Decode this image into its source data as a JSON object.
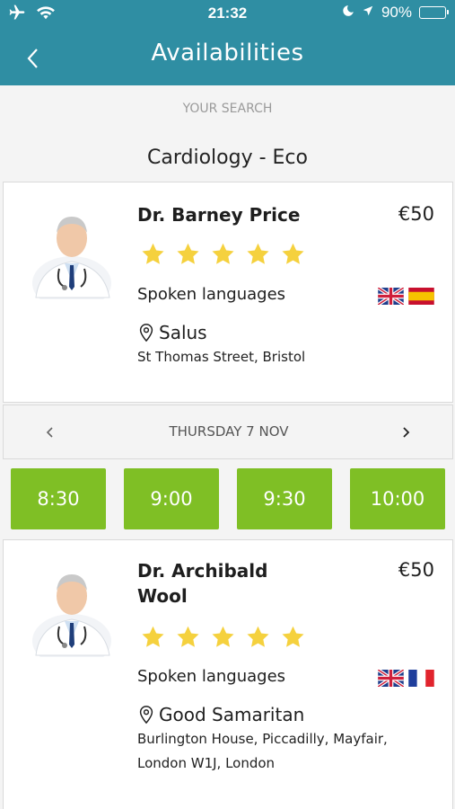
{
  "status_bar": {
    "time": "21:32",
    "battery": "90%",
    "battery_level": 0.9
  },
  "header": {
    "title": "Availabilities"
  },
  "search": {
    "label": "YOUR SEARCH",
    "value": "Cardiology - Eco"
  },
  "doctors": [
    {
      "name": "Dr. Barney Price",
      "price": "€50",
      "rating": 5,
      "languages_label": "Spoken languages",
      "languages": [
        "english-flag",
        "spanish-flag"
      ],
      "place": "Salus",
      "address": "St Thomas Street, Bristol"
    },
    {
      "name": "Dr. Archibald Wool",
      "price": "€50",
      "rating": 5,
      "languages_label": "Spoken languages",
      "languages": [
        "english-flag",
        "french-flag"
      ],
      "place": "Good Samaritan",
      "address": "Burlington House, Piccadilly, Mayfair, London W1J, London"
    }
  ],
  "date_nav": {
    "date": "THURSDAY 7 NOV"
  },
  "slots": [
    "8:30",
    "9:00",
    "9:30",
    "10:00"
  ],
  "colors": {
    "header": "#2f8ea3",
    "slot": "#7fbf25",
    "star": "#f5d13e"
  }
}
